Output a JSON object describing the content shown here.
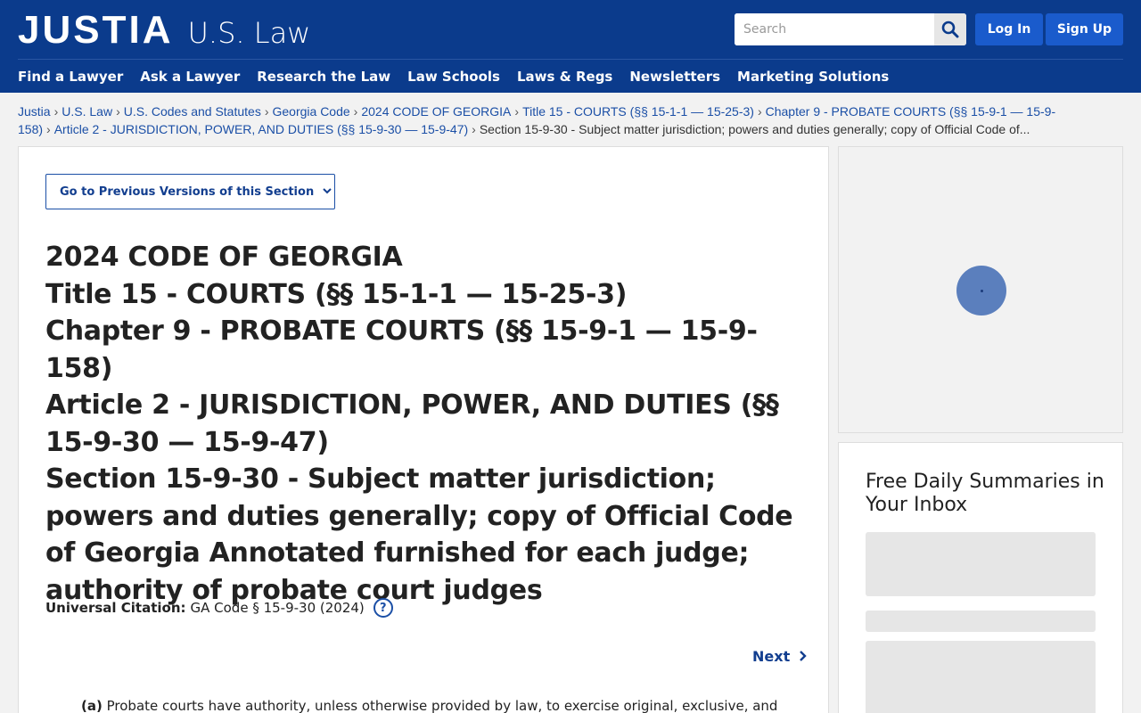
{
  "header": {
    "logo": "JUSTIA",
    "section": "U.S. Law",
    "search_placeholder": "Search",
    "login": "Log In",
    "signup": "Sign Up",
    "nav": [
      "Find a Lawyer",
      "Ask a Lawyer",
      "Research the Law",
      "Law Schools",
      "Laws & Regs",
      "Newsletters",
      "Marketing Solutions"
    ]
  },
  "breadcrumb": {
    "items": [
      "Justia",
      "U.S. Law",
      "U.S. Codes and Statutes",
      "Georgia Code",
      "2024 CODE OF GEORGIA",
      "Title 15 - COURTS (§§ 15-1-1 — 15-25-3)",
      "Chapter 9 - PROBATE COURTS (§§ 15-9-1 — 15-9-158)",
      "Article 2 - JURISDICTION, POWER, AND DUTIES (§§ 15-9-30 — 15-9-47)"
    ],
    "current": "Section 15-9-30 - Subject matter jurisdiction; powers and duties generally; copy of Official Code of..."
  },
  "main": {
    "prev_versions": "Go to Previous Versions of this Section",
    "heading": {
      "code": "2024 CODE OF GEORGIA",
      "title": "Title 15 - COURTS (§§ 15-1-1 — 15-25-3)",
      "chapter": "Chapter 9 - PROBATE COURTS (§§ 15-9-1 — 15-9-158)",
      "article": "Article 2 - JURISDICTION, POWER, AND DUTIES (§§ 15-9-30 — 15-9-47)",
      "section": "Section 15-9-30 - Subject matter jurisdiction; powers and duties generally; copy of Official Code of Georgia Annotated furnished for each judge; authority of probate court judges"
    },
    "citation_label": "Universal Citation:",
    "citation_value": "GA Code § 15-9-30 (2024)",
    "help": "?",
    "next": "Next",
    "para_marker": "(a)",
    "para_text": "Probate courts have authority, unless otherwise provided by law, to exercise original, exclusive, and"
  },
  "sidebar": {
    "newsletter_title": "Free Daily Summaries in Your Inbox"
  }
}
